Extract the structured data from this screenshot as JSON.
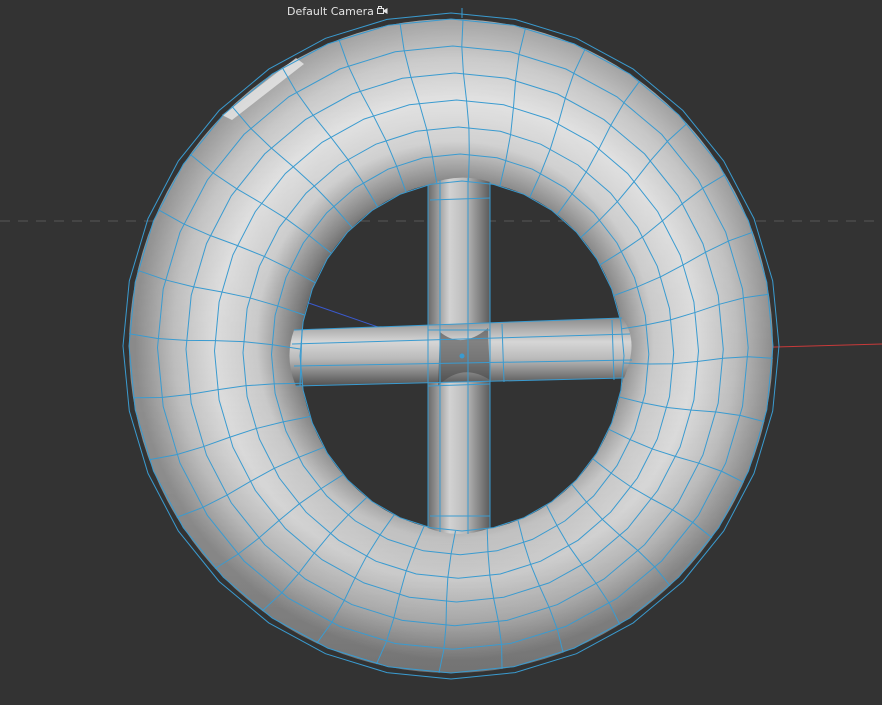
{
  "viewport": {
    "camera_label": "Default Camera",
    "camera_icon": "camera-icon",
    "background": "#333333",
    "object": "torus-with-cross-spokes",
    "colors": {
      "wireframe": "#3a9bd0",
      "surface_light": "#d8d8d8",
      "surface_dark": "#5f5f5f",
      "axis_x": "#c83a3a",
      "axis_z": "#3a5ad0",
      "grid_horizon": "#555555"
    }
  }
}
